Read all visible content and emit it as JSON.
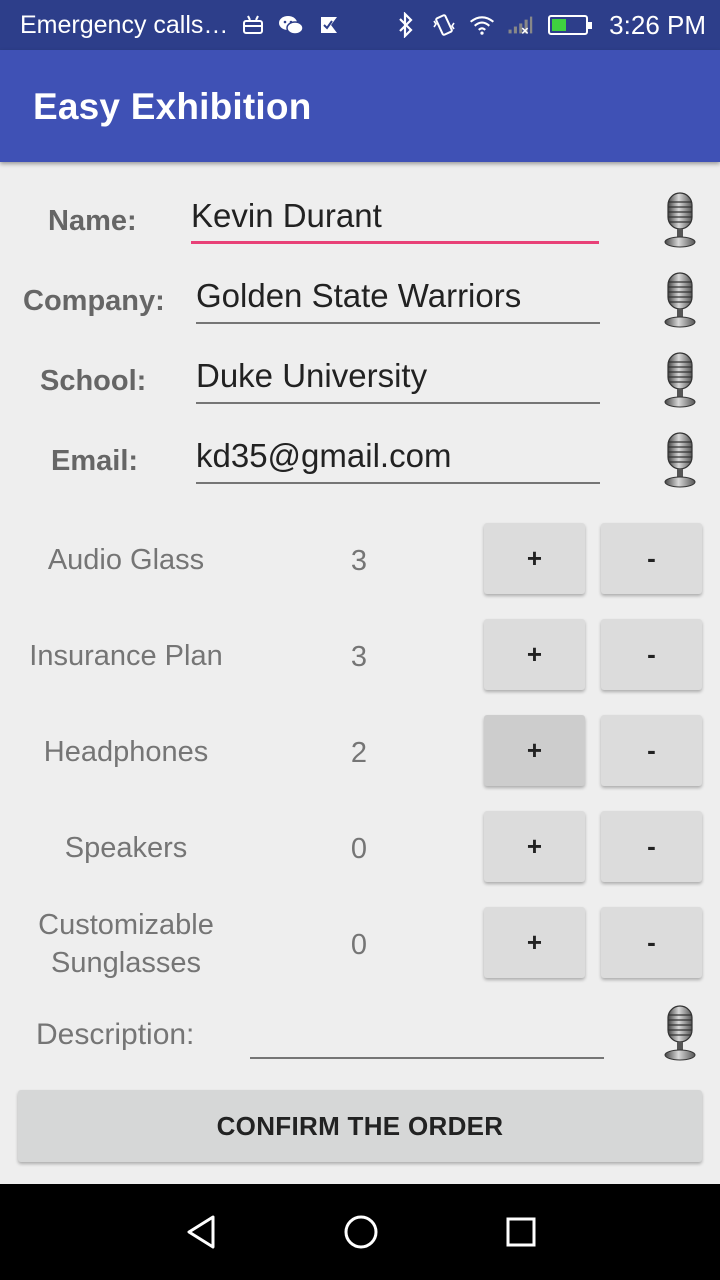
{
  "status_bar": {
    "notification_text": "Emergency calls…",
    "time": "3:26 PM",
    "left_icons": [
      "android-icon",
      "wechat-icon",
      "check-flag-icon"
    ],
    "right_icons": [
      "bluetooth-icon",
      "vibrate-icon",
      "wifi-icon",
      "signal-icon",
      "battery-icon"
    ]
  },
  "app_bar": {
    "title": "Easy Exhibition"
  },
  "form": {
    "name": {
      "label": "Name:",
      "value": "Kevin Durant"
    },
    "company": {
      "label": "Company:",
      "value": "Golden State Warriors"
    },
    "school": {
      "label": "School:",
      "value": "Duke University"
    },
    "email": {
      "label": "Email:",
      "value": "kd35@gmail.com"
    }
  },
  "products": [
    {
      "name": "Audio Glass",
      "qty": "3",
      "plus": "+",
      "minus": "-"
    },
    {
      "name": "Insurance Plan",
      "qty": "3",
      "plus": "+",
      "minus": "-"
    },
    {
      "name": "Headphones",
      "qty": "2",
      "plus": "+",
      "minus": "-"
    },
    {
      "name": "Speakers",
      "qty": "0",
      "plus": "+",
      "minus": "-"
    },
    {
      "name": "Customizable Sunglasses",
      "qty": "0",
      "plus": "+",
      "minus": "-"
    }
  ],
  "description": {
    "label": "Description:",
    "value": ""
  },
  "confirm_label": "CONFIRM THE ORDER",
  "colors": {
    "primary": "#3f51b5",
    "primary_dark": "#2d3e8a",
    "accent": "#e84077"
  }
}
